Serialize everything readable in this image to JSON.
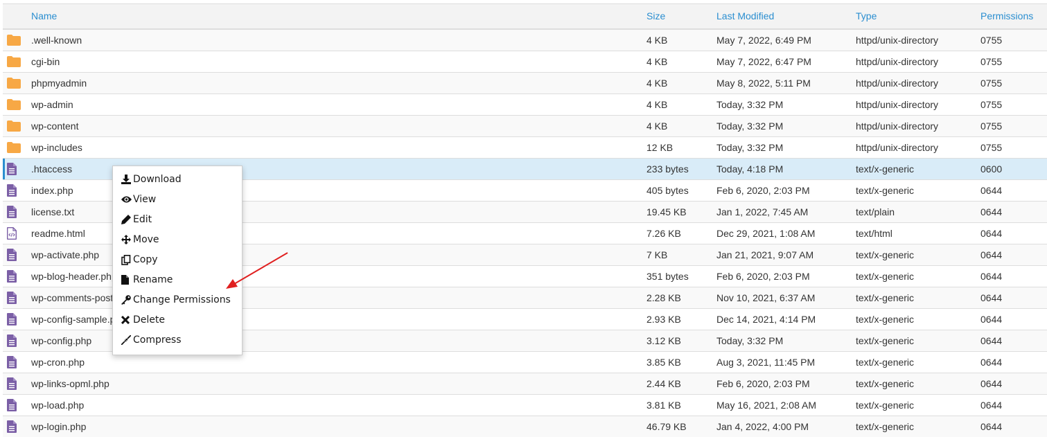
{
  "table": {
    "headers": {
      "name": "Name",
      "size": "Size",
      "modified": "Last Modified",
      "type": "Type",
      "permissions": "Permissions"
    },
    "rows": [
      {
        "icon": "folder-icon",
        "name": ".well-known",
        "size": "4 KB",
        "modified": "May 7, 2022, 6:49 PM",
        "type": "httpd/unix-directory",
        "perm": "0755"
      },
      {
        "icon": "folder-icon",
        "name": "cgi-bin",
        "size": "4 KB",
        "modified": "May 7, 2022, 6:47 PM",
        "type": "httpd/unix-directory",
        "perm": "0755"
      },
      {
        "icon": "folder-icon",
        "name": "phpmyadmin",
        "size": "4 KB",
        "modified": "May 8, 2022, 5:11 PM",
        "type": "httpd/unix-directory",
        "perm": "0755"
      },
      {
        "icon": "folder-icon",
        "name": "wp-admin",
        "size": "4 KB",
        "modified": "Today, 3:32 PM",
        "type": "httpd/unix-directory",
        "perm": "0755"
      },
      {
        "icon": "folder-icon",
        "name": "wp-content",
        "size": "4 KB",
        "modified": "Today, 3:32 PM",
        "type": "httpd/unix-directory",
        "perm": "0755"
      },
      {
        "icon": "folder-icon",
        "name": "wp-includes",
        "size": "12 KB",
        "modified": "Today, 3:32 PM",
        "type": "httpd/unix-directory",
        "perm": "0755"
      },
      {
        "icon": "file-text-icon",
        "name": ".htaccess",
        "size": "233 bytes",
        "modified": "Today, 4:18 PM",
        "type": "text/x-generic",
        "perm": "0600",
        "selected": true
      },
      {
        "icon": "file-text-icon",
        "name": "index.php",
        "size": "405 bytes",
        "modified": "Feb 6, 2020, 2:03 PM",
        "type": "text/x-generic",
        "perm": "0644"
      },
      {
        "icon": "file-text-icon",
        "name": "license.txt",
        "size": "19.45 KB",
        "modified": "Jan 1, 2022, 7:45 AM",
        "type": "text/plain",
        "perm": "0644"
      },
      {
        "icon": "file-code-icon",
        "name": "readme.html",
        "size": "7.26 KB",
        "modified": "Dec 29, 2021, 1:08 AM",
        "type": "text/html",
        "perm": "0644"
      },
      {
        "icon": "file-text-icon",
        "name": "wp-activate.php",
        "size": "7 KB",
        "modified": "Jan 21, 2021, 9:07 AM",
        "type": "text/x-generic",
        "perm": "0644"
      },
      {
        "icon": "file-text-icon",
        "name": "wp-blog-header.php",
        "size": "351 bytes",
        "modified": "Feb 6, 2020, 2:03 PM",
        "type": "text/x-generic",
        "perm": "0644"
      },
      {
        "icon": "file-text-icon",
        "name": "wp-comments-post.php",
        "size": "2.28 KB",
        "modified": "Nov 10, 2021, 6:37 AM",
        "type": "text/x-generic",
        "perm": "0644"
      },
      {
        "icon": "file-text-icon",
        "name": "wp-config-sample.php",
        "size": "2.93 KB",
        "modified": "Dec 14, 2021, 4:14 PM",
        "type": "text/x-generic",
        "perm": "0644"
      },
      {
        "icon": "file-text-icon",
        "name": "wp-config.php",
        "size": "3.12 KB",
        "modified": "Today, 3:32 PM",
        "type": "text/x-generic",
        "perm": "0644"
      },
      {
        "icon": "file-text-icon",
        "name": "wp-cron.php",
        "size": "3.85 KB",
        "modified": "Aug 3, 2021, 11:45 PM",
        "type": "text/x-generic",
        "perm": "0644"
      },
      {
        "icon": "file-text-icon",
        "name": "wp-links-opml.php",
        "size": "2.44 KB",
        "modified": "Feb 6, 2020, 2:03 PM",
        "type": "text/x-generic",
        "perm": "0644"
      },
      {
        "icon": "file-text-icon",
        "name": "wp-load.php",
        "size": "3.81 KB",
        "modified": "May 16, 2021, 2:08 AM",
        "type": "text/x-generic",
        "perm": "0644"
      },
      {
        "icon": "file-text-icon",
        "name": "wp-login.php",
        "size": "46.79 KB",
        "modified": "Jan 4, 2022, 4:00 PM",
        "type": "text/x-generic",
        "perm": "0644"
      }
    ]
  },
  "context_menu": {
    "items": [
      {
        "icon": "download-icon",
        "label": "Download"
      },
      {
        "icon": "eye-icon",
        "label": "View"
      },
      {
        "icon": "pencil-icon",
        "label": "Edit"
      },
      {
        "icon": "move-icon",
        "label": "Move"
      },
      {
        "icon": "copy-icon",
        "label": "Copy"
      },
      {
        "icon": "file-icon",
        "label": "Rename"
      },
      {
        "icon": "key-icon",
        "label": "Change Permissions"
      },
      {
        "icon": "close-icon",
        "label": "Delete"
      },
      {
        "icon": "compress-icon",
        "label": "Compress"
      }
    ]
  },
  "colors": {
    "link": "#2a8ed0",
    "folder": "#f7a845",
    "file": "#7b5fa6",
    "selected_row": "#d9ecf8",
    "arrow": "#e02020"
  }
}
